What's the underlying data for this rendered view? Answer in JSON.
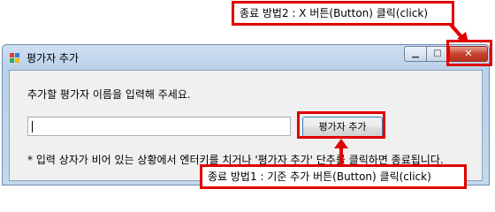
{
  "callouts": {
    "top": "종료 방법2 : X 버튼(Button) 클릭(click)",
    "bottom": "종료 방법1 : 기준 추가 버튼(Button) 클릭(click)"
  },
  "window": {
    "title": "평가자 추가",
    "prompt": "추가할 평가자 이름을 입력해 주세요.",
    "input_value": "",
    "add_button_label": "평가자 추가",
    "note": "* 입력 상자가 비어 있는 상황에서 엔터키를 치거나 '평가자 추가' 단추를 클릭하면 종료됩니다."
  },
  "icons": {
    "app": "window-app-icon",
    "minimize": "minimize-icon",
    "maximize": "maximize-icon",
    "close": "close-icon"
  },
  "colors": {
    "annotation_red": "#e00000",
    "close_button": "#c6432f",
    "titlebar": "#b9d1ea"
  }
}
